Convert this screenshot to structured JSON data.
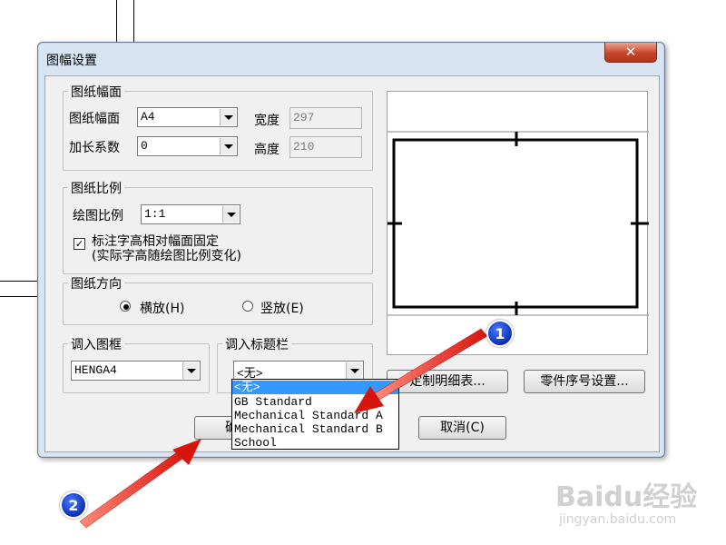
{
  "dialog": {
    "title": "图幅设置",
    "close_icon": "close-icon",
    "close_glyph": "✕"
  },
  "paper_size": {
    "group_label": "图纸幅面",
    "size_label": "图纸幅面",
    "size_value": "A4",
    "extend_label": "加长系数",
    "extend_value": "0",
    "width_label": "宽度",
    "width_value": "297",
    "height_label": "高度",
    "height_value": "210"
  },
  "scale": {
    "group_label": "图纸比例",
    "ratio_label": "绘图比例",
    "ratio_value": "1:1",
    "fixed_text_checked": true,
    "fixed_text_label_line1": "标注字高相对幅面固定",
    "fixed_text_label_line2": "(实际字高随绘图比例变化)"
  },
  "orientation": {
    "group_label": "图纸方向",
    "landscape_label": "横放(H)",
    "portrait_label": "竖放(E)",
    "selected": "landscape"
  },
  "frame": {
    "group_label": "调入图框",
    "value": "HENGA4"
  },
  "title_block": {
    "group_label": "调入标题栏",
    "value": "<无>",
    "options": [
      "<无>",
      "GB Standard",
      "Mechanical Standard A",
      "Mechanical Standard B",
      "School"
    ],
    "highlighted_index": 0
  },
  "buttons": {
    "detail_table": "定制明细表...",
    "part_number": "零件序号设置...",
    "ok": "确定",
    "cancel": "取消(C)"
  },
  "annotations": {
    "badge1": "1",
    "badge2": "2",
    "arrow_color": "#e0201a"
  },
  "watermark": {
    "brand": "Baidu经验",
    "url": "jingyan.baidu.com"
  }
}
